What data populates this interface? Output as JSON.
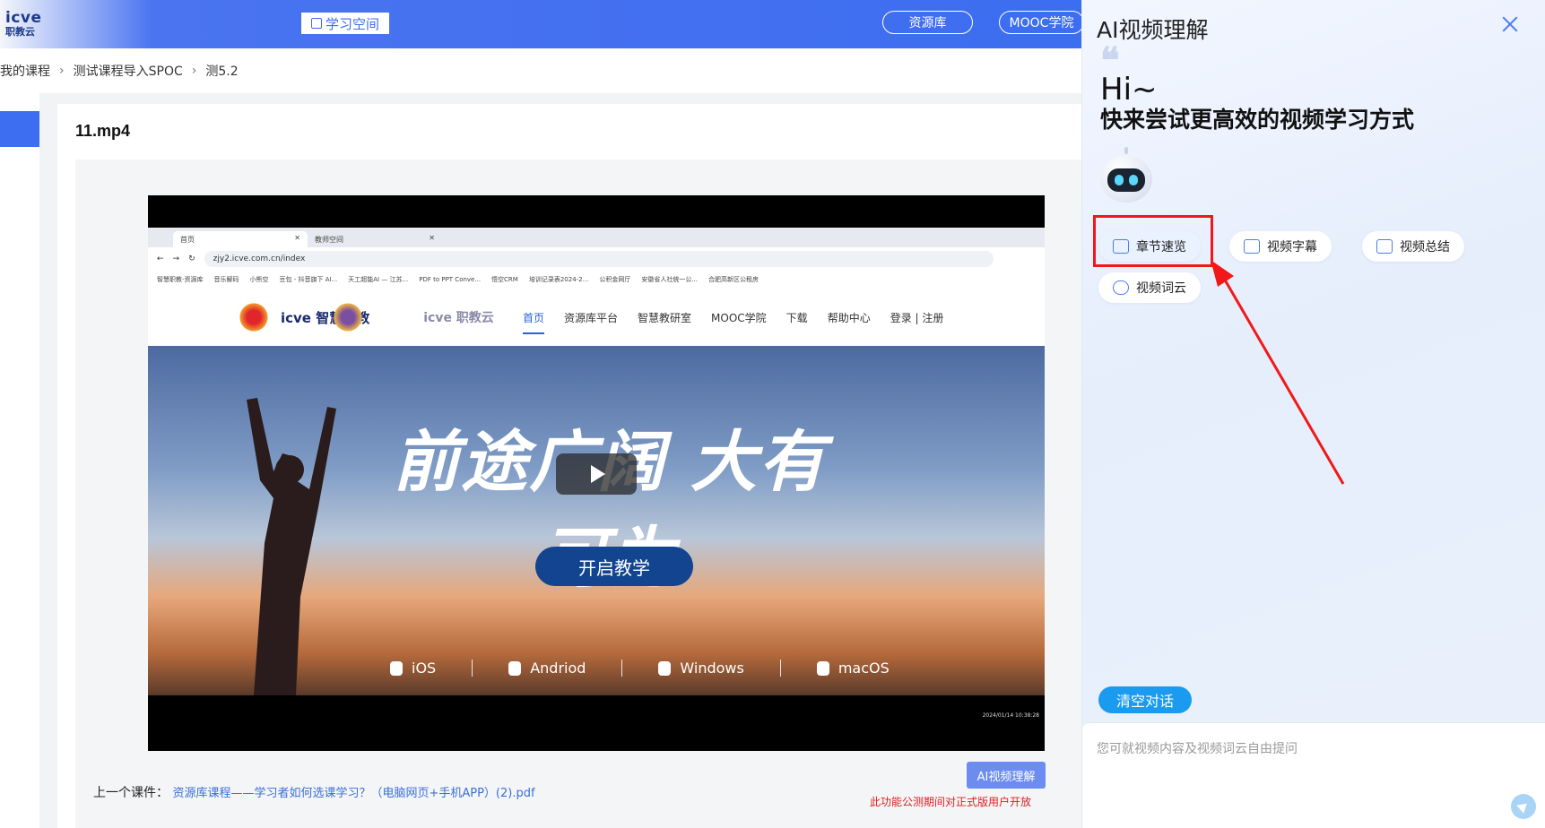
{
  "header": {
    "logo_top": "icve",
    "logo_bottom": "职教云",
    "space_label": "学习空间",
    "nav": [
      "资源库",
      "MOOC学院"
    ]
  },
  "breadcrumb": [
    "我的课程",
    "测试课程导入SPOC",
    "测5.2"
  ],
  "lesson": {
    "title": "11.mp4"
  },
  "video": {
    "tabs": [
      "首页",
      "教师空间"
    ],
    "url": "zjy2.icve.com.cn/index",
    "bookmarks": [
      "智慧职教-资源库",
      "音乐解码",
      "小熊空",
      "豆包 - 抖音旗下 AI...",
      "天工超能AI — 江苏...",
      "PDF to PPT Conve...",
      "悟空CRM",
      "培训记录表2024-2...",
      "公积金网厅",
      "安徽省人社统一公...",
      "合肥高新区公租房"
    ],
    "site_brand_1": "icve 智慧职教",
    "site_brand_2": "icve 职教云",
    "site_links": [
      "首页",
      "资源库平台",
      "智慧教研室",
      "MOOC学院",
      "下载",
      "帮助中心",
      "登录 | 注册"
    ],
    "hero_slogan": "前途广阔 大有可为",
    "start_label": "开启教学",
    "platforms": [
      "iOS",
      "Andriod",
      "Windows",
      "macOS"
    ],
    "timestamp": "2024/01/14 10:38:28"
  },
  "footer": {
    "prev_label": "上一个课件：",
    "prev_link": "资源库课程——学习者如何选课学习？（电脑网页+手机APP）(2).pdf",
    "ai_button": "AI视频理解",
    "ai_note": "此功能公测期间对正式版用户开放"
  },
  "panel": {
    "title": "AI视频理解",
    "greeting": "Hi~",
    "subtitle": "快来尝试更高效的视频学习方式",
    "chips": [
      "章节速览",
      "视频字幕",
      "视频总结",
      "视频词云"
    ],
    "clear_label": "清空对话",
    "input_placeholder": "您可就视频内容及视频词云自由提问"
  },
  "colors": {
    "brand_blue": "#3d6df0",
    "highlight_red": "#f01818",
    "clear_blue": "#1a9bf0"
  }
}
